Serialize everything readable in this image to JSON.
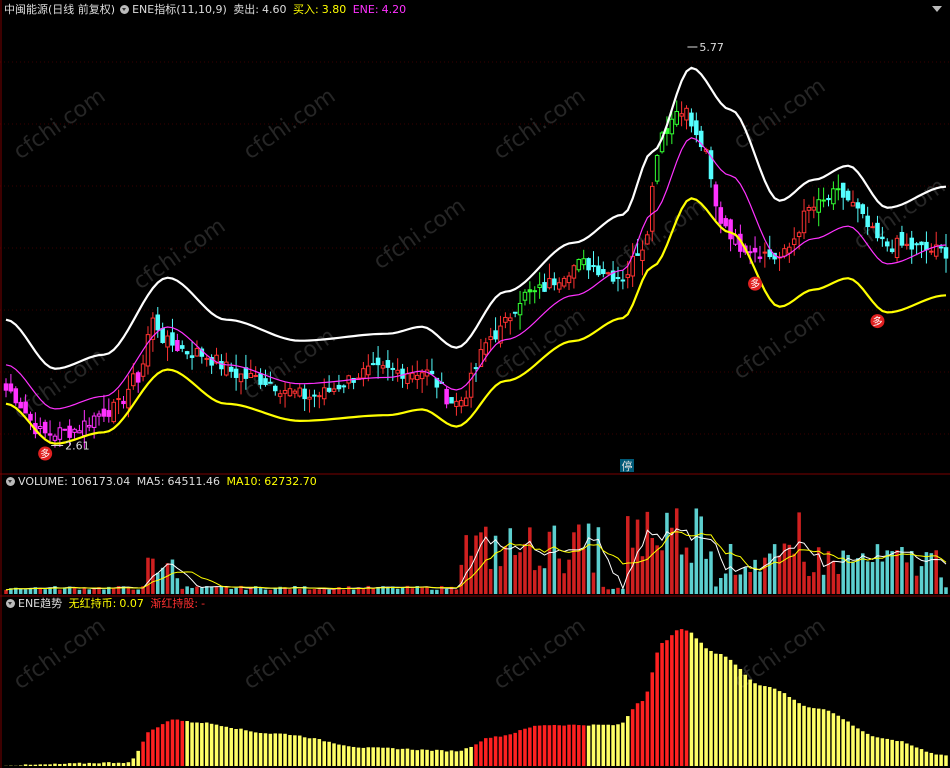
{
  "header": {
    "title": "中闽能源(日线 前复权)",
    "indicator": "ENE指标(11,10,9)",
    "sell_label": "卖出:",
    "sell_value": "4.60",
    "buy_label": "买入:",
    "buy_value": "3.80",
    "ene_label": "ENE:",
    "ene_value": "4.20"
  },
  "volume_header": {
    "volume_label": "VOLUME:",
    "volume_value": "106173.04",
    "ma5_label": "MA5:",
    "ma5_value": "64511.46",
    "ma10_label": "MA10:",
    "ma10_value": "62732.70"
  },
  "trend_header": {
    "name": "ENE趋势",
    "no_red_label": "无红持币:",
    "no_red_value": "0.07",
    "red_label": "渐红持股:",
    "red_value": "-"
  },
  "annotations": {
    "high_price": "5.77",
    "low_price": "2.61",
    "mark_char": "多",
    "stop_char": "停",
    "watermark": "cfchi.com"
  },
  "colors": {
    "background": "#000000",
    "up": "#ff3232",
    "down": "#54ffff",
    "strong_up": "#32ff32",
    "strong_down": "#ff32ff",
    "upper_band": "#ffffff",
    "mid_band": "#ff32ff",
    "lower_band": "#ffff00",
    "ma5": "#ffffff",
    "ma10": "#ffff00",
    "trend_red": "#ff2020",
    "trend_yellow": "#ffff66"
  },
  "chart_data": [
    {
      "type": "candlestick",
      "title": "中闽能源(日线 前复权) ENE指标(11,10,9)",
      "ylim": [
        2.4,
        6.0
      ],
      "price_high": 5.77,
      "price_low": 2.61,
      "bands_last": {
        "upper": 4.6,
        "mid": 4.2,
        "lower": 3.8
      },
      "mid_band_keypoints": [
        [
          0,
          3.25
        ],
        [
          10,
          2.9
        ],
        [
          20,
          3.0
        ],
        [
          33,
          3.55
        ],
        [
          45,
          3.25
        ],
        [
          60,
          3.1
        ],
        [
          78,
          3.15
        ],
        [
          85,
          3.2
        ],
        [
          92,
          3.05
        ],
        [
          102,
          3.45
        ],
        [
          116,
          3.8
        ],
        [
          126,
          4.0
        ],
        [
          132,
          4.45
        ],
        [
          140,
          5.05
        ],
        [
          148,
          4.75
        ],
        [
          158,
          4.1
        ],
        [
          165,
          4.25
        ],
        [
          172,
          4.35
        ],
        [
          180,
          4.05
        ],
        [
          192,
          4.2
        ]
      ],
      "close_keypoints": [
        [
          0,
          3.05
        ],
        [
          8,
          2.7
        ],
        [
          12,
          2.72
        ],
        [
          22,
          2.9
        ],
        [
          27,
          3.15
        ],
        [
          30,
          3.6
        ],
        [
          33,
          3.42
        ],
        [
          38,
          3.35
        ],
        [
          50,
          3.15
        ],
        [
          62,
          3.0
        ],
        [
          75,
          3.2
        ],
        [
          85,
          3.2
        ],
        [
          92,
          2.95
        ],
        [
          100,
          3.5
        ],
        [
          106,
          3.8
        ],
        [
          118,
          4.05
        ],
        [
          126,
          3.95
        ],
        [
          130,
          4.2
        ],
        [
          134,
          5.1
        ],
        [
          138,
          5.3
        ],
        [
          142,
          5.0
        ],
        [
          146,
          4.4
        ],
        [
          150,
          4.2
        ],
        [
          158,
          4.1
        ],
        [
          165,
          4.5
        ],
        [
          170,
          4.6
        ],
        [
          180,
          4.2
        ],
        [
          192,
          4.15
        ]
      ],
      "signals_duo": [
        8,
        153,
        178
      ],
      "candle_count": 193
    },
    {
      "type": "bar",
      "title": "VOLUME",
      "series": [
        {
          "name": "VOLUME",
          "last": 106173.04
        },
        {
          "name": "MA5",
          "last": 64511.46
        },
        {
          "name": "MA10",
          "last": 62732.7
        }
      ]
    },
    {
      "type": "bar",
      "title": "ENE趋势",
      "ylim": [
        0,
        1
      ],
      "trend_keypoints": [
        [
          0,
          0.0
        ],
        [
          25,
          0.02
        ],
        [
          30,
          0.25
        ],
        [
          34,
          0.32
        ],
        [
          38,
          0.3
        ],
        [
          55,
          0.22
        ],
        [
          75,
          0.12
        ],
        [
          92,
          0.1
        ],
        [
          100,
          0.2
        ],
        [
          110,
          0.28
        ],
        [
          125,
          0.28
        ],
        [
          130,
          0.45
        ],
        [
          134,
          0.85
        ],
        [
          138,
          0.95
        ],
        [
          145,
          0.78
        ],
        [
          155,
          0.55
        ],
        [
          165,
          0.4
        ],
        [
          180,
          0.18
        ],
        [
          192,
          0.07
        ]
      ],
      "red_ranges": [
        [
          28,
          36
        ],
        [
          96,
          118
        ],
        [
          128,
          139
        ]
      ]
    }
  ]
}
